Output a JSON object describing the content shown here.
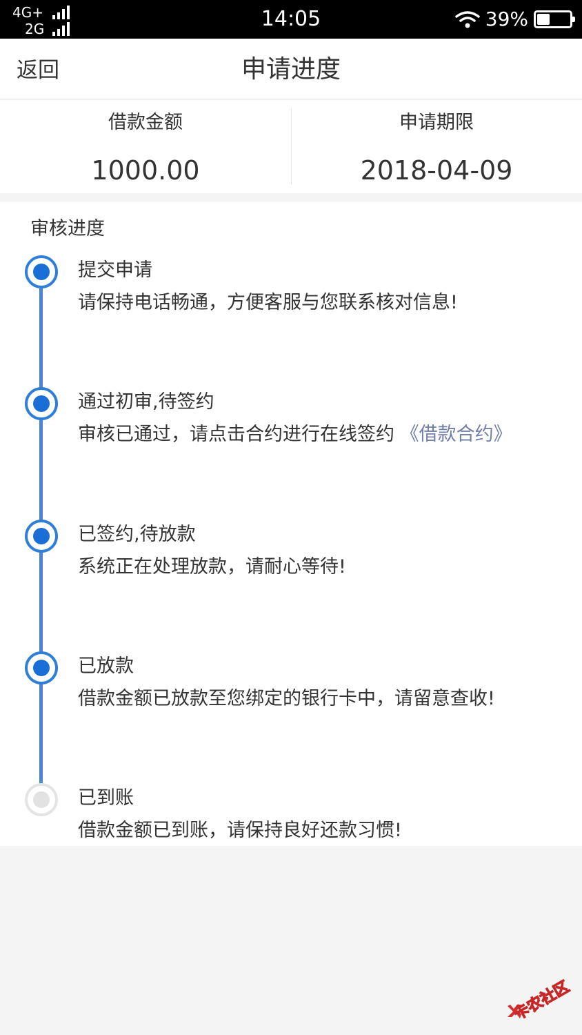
{
  "status_bar": {
    "network_1": "4G+",
    "network_2": "2G",
    "time": "14:05",
    "battery_percent": "39%",
    "battery_level": 0.39,
    "icons": [
      "signal-icon",
      "wifi-icon",
      "battery-icon"
    ]
  },
  "header": {
    "back_label": "返回",
    "title": "申请进度"
  },
  "summary": {
    "amount_label": "借款金额",
    "amount_value": "1000.00",
    "term_label": "申请期限",
    "term_value": "2018-04-09"
  },
  "progress": {
    "title": "审核进度",
    "steps": [
      {
        "title": "提交申请",
        "desc": "请保持电话畅通，方便客服与您联系核对信息!",
        "active": true
      },
      {
        "title": "通过初审,待签约",
        "desc": "审核已通过，请点击合约进行在线签约",
        "link": "《借款合约》",
        "active": true
      },
      {
        "title": "已签约,待放款",
        "desc": "系统正在处理放款，请耐心等待!",
        "active": true
      },
      {
        "title": "已放款",
        "desc": "借款金额已放款至您绑定的银行卡中，请留意查收!",
        "active": true
      },
      {
        "title": "已到账",
        "desc": "借款金额已到账，请保持良好还款习惯!",
        "active": false
      }
    ]
  },
  "watermark": {
    "text": "卡农社区"
  },
  "colors": {
    "accent": "#1a6fd6",
    "timeline": "#4a86d4",
    "link": "#6f7fa8",
    "inactive": "#e2e2e2"
  }
}
